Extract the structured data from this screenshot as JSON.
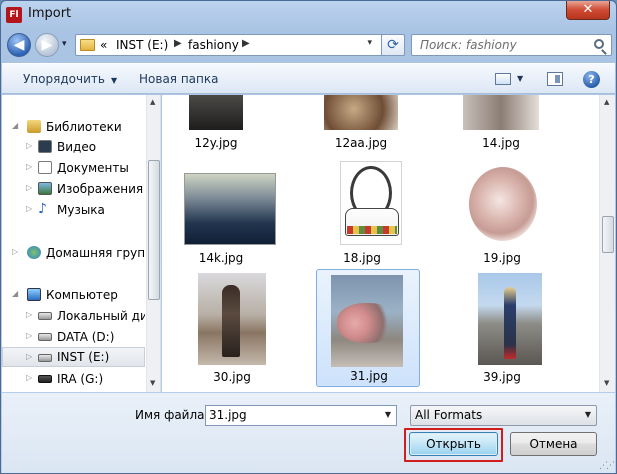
{
  "window": {
    "title": "Import",
    "app_icon": "Fl",
    "close": "✕"
  },
  "nav": {
    "back": "◀",
    "forward": "▶",
    "dropdown": "▾",
    "breadcrumb": [
      "«",
      "INST (E:)",
      "fashiony"
    ],
    "refresh": "⟳",
    "search_placeholder": "Поиск: fashiony"
  },
  "toolbar": {
    "organize": "Упорядочить",
    "new_folder": "Новая папка",
    "help": "?"
  },
  "tree": [
    {
      "label": "Библиотеки",
      "icon": "library-icon",
      "arrow": "◢"
    },
    {
      "label": "Видео",
      "icon": "video-icon",
      "arrow": "▷"
    },
    {
      "label": "Документы",
      "icon": "documents-icon",
      "arrow": "▷"
    },
    {
      "label": "Изображения",
      "icon": "pictures-icon",
      "arrow": "▷"
    },
    {
      "label": "Музыка",
      "icon": "music-icon",
      "arrow": "▷"
    },
    {
      "label": "Домашняя группа",
      "icon": "homegroup-icon",
      "arrow": "▷"
    },
    {
      "label": "Компьютер",
      "icon": "computer-icon",
      "arrow": "◢"
    },
    {
      "label": "Локальный диск",
      "icon": "drive-icon",
      "arrow": "▷"
    },
    {
      "label": "DATA (D:)",
      "icon": "drive-icon",
      "arrow": "▷"
    },
    {
      "label": "INST (E:)",
      "icon": "drive-icon",
      "arrow": "▷"
    },
    {
      "label": "IRA (G:)",
      "icon": "usb-drive-icon",
      "arrow": "▷"
    }
  ],
  "files": [
    {
      "name": "12y.jpg"
    },
    {
      "name": "12aa.jpg"
    },
    {
      "name": "14.jpg"
    },
    {
      "name": "14k.jpg"
    },
    {
      "name": "18.jpg"
    },
    {
      "name": "19.jpg"
    },
    {
      "name": "30.jpg"
    },
    {
      "name": "31.jpg",
      "selected": true
    },
    {
      "name": "39.jpg"
    }
  ],
  "bottom": {
    "filename_label": "Имя файла:",
    "filename_value": "31.jpg",
    "format_value": "All Formats",
    "open_button": "Открыть",
    "cancel_button": "Отмена"
  },
  "colors": {
    "highlight": "#d21d1d",
    "selection": "#cde2fb"
  }
}
